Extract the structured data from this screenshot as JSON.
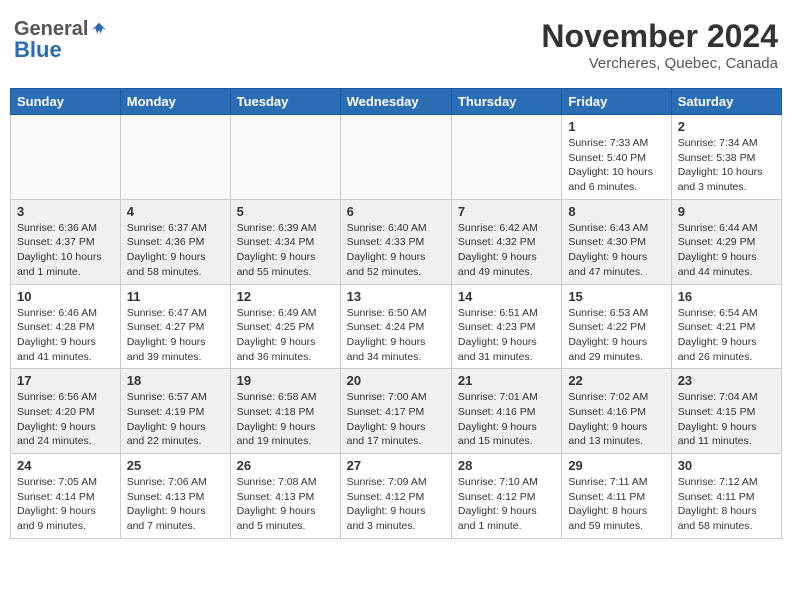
{
  "header": {
    "logo_general": "General",
    "logo_blue": "Blue",
    "month_title": "November 2024",
    "subtitle": "Vercheres, Quebec, Canada"
  },
  "calendar": {
    "headers": [
      "Sunday",
      "Monday",
      "Tuesday",
      "Wednesday",
      "Thursday",
      "Friday",
      "Saturday"
    ],
    "weeks": [
      [
        {
          "day": "",
          "info": ""
        },
        {
          "day": "",
          "info": ""
        },
        {
          "day": "",
          "info": ""
        },
        {
          "day": "",
          "info": ""
        },
        {
          "day": "",
          "info": ""
        },
        {
          "day": "1",
          "info": "Sunrise: 7:33 AM\nSunset: 5:40 PM\nDaylight: 10 hours and 6 minutes."
        },
        {
          "day": "2",
          "info": "Sunrise: 7:34 AM\nSunset: 5:38 PM\nDaylight: 10 hours and 3 minutes."
        }
      ],
      [
        {
          "day": "3",
          "info": "Sunrise: 6:36 AM\nSunset: 4:37 PM\nDaylight: 10 hours and 1 minute."
        },
        {
          "day": "4",
          "info": "Sunrise: 6:37 AM\nSunset: 4:36 PM\nDaylight: 9 hours and 58 minutes."
        },
        {
          "day": "5",
          "info": "Sunrise: 6:39 AM\nSunset: 4:34 PM\nDaylight: 9 hours and 55 minutes."
        },
        {
          "day": "6",
          "info": "Sunrise: 6:40 AM\nSunset: 4:33 PM\nDaylight: 9 hours and 52 minutes."
        },
        {
          "day": "7",
          "info": "Sunrise: 6:42 AM\nSunset: 4:32 PM\nDaylight: 9 hours and 49 minutes."
        },
        {
          "day": "8",
          "info": "Sunrise: 6:43 AM\nSunset: 4:30 PM\nDaylight: 9 hours and 47 minutes."
        },
        {
          "day": "9",
          "info": "Sunrise: 6:44 AM\nSunset: 4:29 PM\nDaylight: 9 hours and 44 minutes."
        }
      ],
      [
        {
          "day": "10",
          "info": "Sunrise: 6:46 AM\nSunset: 4:28 PM\nDaylight: 9 hours and 41 minutes."
        },
        {
          "day": "11",
          "info": "Sunrise: 6:47 AM\nSunset: 4:27 PM\nDaylight: 9 hours and 39 minutes."
        },
        {
          "day": "12",
          "info": "Sunrise: 6:49 AM\nSunset: 4:25 PM\nDaylight: 9 hours and 36 minutes."
        },
        {
          "day": "13",
          "info": "Sunrise: 6:50 AM\nSunset: 4:24 PM\nDaylight: 9 hours and 34 minutes."
        },
        {
          "day": "14",
          "info": "Sunrise: 6:51 AM\nSunset: 4:23 PM\nDaylight: 9 hours and 31 minutes."
        },
        {
          "day": "15",
          "info": "Sunrise: 6:53 AM\nSunset: 4:22 PM\nDaylight: 9 hours and 29 minutes."
        },
        {
          "day": "16",
          "info": "Sunrise: 6:54 AM\nSunset: 4:21 PM\nDaylight: 9 hours and 26 minutes."
        }
      ],
      [
        {
          "day": "17",
          "info": "Sunrise: 6:56 AM\nSunset: 4:20 PM\nDaylight: 9 hours and 24 minutes."
        },
        {
          "day": "18",
          "info": "Sunrise: 6:57 AM\nSunset: 4:19 PM\nDaylight: 9 hours and 22 minutes."
        },
        {
          "day": "19",
          "info": "Sunrise: 6:58 AM\nSunset: 4:18 PM\nDaylight: 9 hours and 19 minutes."
        },
        {
          "day": "20",
          "info": "Sunrise: 7:00 AM\nSunset: 4:17 PM\nDaylight: 9 hours and 17 minutes."
        },
        {
          "day": "21",
          "info": "Sunrise: 7:01 AM\nSunset: 4:16 PM\nDaylight: 9 hours and 15 minutes."
        },
        {
          "day": "22",
          "info": "Sunrise: 7:02 AM\nSunset: 4:16 PM\nDaylight: 9 hours and 13 minutes."
        },
        {
          "day": "23",
          "info": "Sunrise: 7:04 AM\nSunset: 4:15 PM\nDaylight: 9 hours and 11 minutes."
        }
      ],
      [
        {
          "day": "24",
          "info": "Sunrise: 7:05 AM\nSunset: 4:14 PM\nDaylight: 9 hours and 9 minutes."
        },
        {
          "day": "25",
          "info": "Sunrise: 7:06 AM\nSunset: 4:13 PM\nDaylight: 9 hours and 7 minutes."
        },
        {
          "day": "26",
          "info": "Sunrise: 7:08 AM\nSunset: 4:13 PM\nDaylight: 9 hours and 5 minutes."
        },
        {
          "day": "27",
          "info": "Sunrise: 7:09 AM\nSunset: 4:12 PM\nDaylight: 9 hours and 3 minutes."
        },
        {
          "day": "28",
          "info": "Sunrise: 7:10 AM\nSunset: 4:12 PM\nDaylight: 9 hours and 1 minute."
        },
        {
          "day": "29",
          "info": "Sunrise: 7:11 AM\nSunset: 4:11 PM\nDaylight: 8 hours and 59 minutes."
        },
        {
          "day": "30",
          "info": "Sunrise: 7:12 AM\nSunset: 4:11 PM\nDaylight: 8 hours and 58 minutes."
        }
      ]
    ]
  }
}
